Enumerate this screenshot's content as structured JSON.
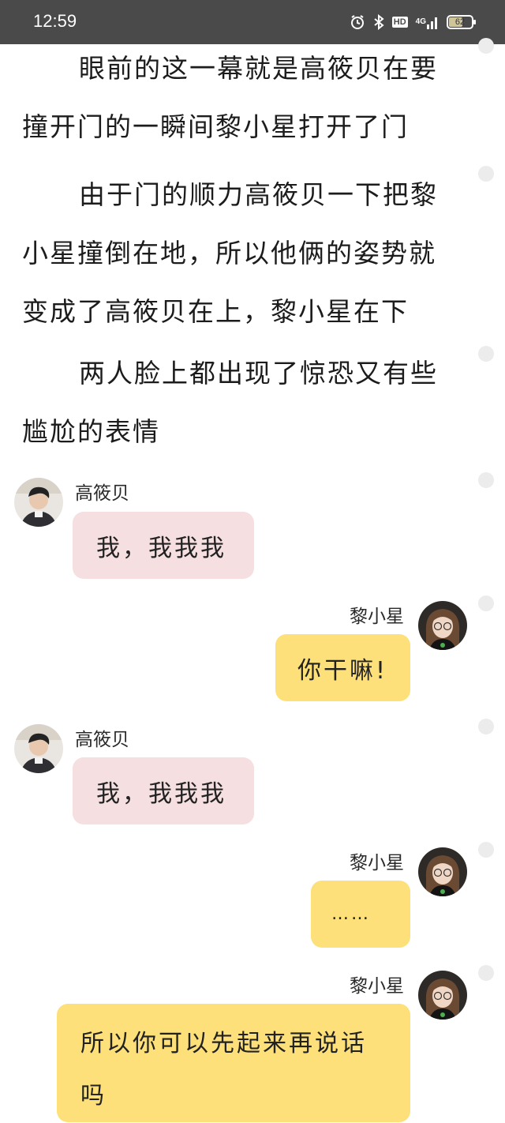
{
  "status_bar": {
    "time": "12:59",
    "hd_label": "HD",
    "network": "4G",
    "battery_level": "62",
    "battery_fraction": 0.62
  },
  "narration": [
    {
      "text": "眼前的这一幕就是高筱贝在要撞开门的一瞬间黎小星打开了门"
    },
    {
      "text": "由于门的顺力高筱贝一下把黎小星撞倒在地，所以他俩的姿势就变成了高筱贝在上，黎小星在下"
    },
    {
      "text": "两人脸上都出现了惊恐又有些尴尬的表情"
    }
  ],
  "messages": [
    {
      "speaker": "高筱贝",
      "side": "left",
      "text": "我，我我我"
    },
    {
      "speaker": "黎小星",
      "side": "right",
      "text": "你干嘛!"
    },
    {
      "speaker": "高筱贝",
      "side": "left",
      "text": "我，我我我"
    },
    {
      "speaker": "黎小星",
      "side": "right",
      "text": "……"
    },
    {
      "speaker": "黎小星",
      "side": "right",
      "text": "所以你可以先起来再说话吗"
    }
  ],
  "colors": {
    "status_bar_bg": "#4a4a4a",
    "left_bubble": "#f5dfe0",
    "right_bubble": "#fde07a",
    "side_dot": "#ececec"
  },
  "icons": [
    "alarm-icon",
    "bluetooth-icon",
    "hd-icon",
    "signal-icon",
    "battery-icon"
  ]
}
